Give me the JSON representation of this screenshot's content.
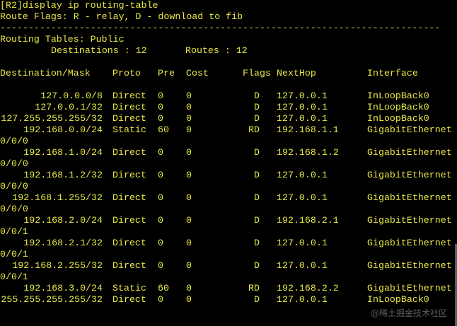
{
  "terminal": {
    "command": "[R2]display ip routing-table",
    "flags_line": "Route Flags: R - relay, D - download to fib",
    "separator": "------------------------------------------------------------------------------",
    "table_title": "Routing Tables: Public",
    "destinations_label": "Destinations : 12",
    "routes_label": "Routes : 12",
    "headers": [
      "Destination/Mask",
      "Proto",
      "Pre",
      "Cost",
      "Flags",
      "NextHop",
      "Interface"
    ],
    "rows": [
      [
        "127.0.0.0/8",
        "Direct",
        "0",
        "0",
        "D",
        "127.0.0.1",
        "InLoopBack0"
      ],
      [
        "127.0.0.1/32",
        "Direct",
        "0",
        "0",
        "D",
        "127.0.0.1",
        "InLoopBack0"
      ],
      [
        "127.255.255.255/32",
        "Direct",
        "0",
        "0",
        "D",
        "127.0.0.1",
        "InLoopBack0"
      ],
      [
        "192.168.0.0/24",
        "Static",
        "60",
        "0",
        "RD",
        "192.168.1.1",
        "GigabitEthernet"
      ],
      [
        "192.168.1.0/24",
        "Direct",
        "0",
        "0",
        "D",
        "192.168.1.2",
        "GigabitEthernet"
      ],
      [
        "192.168.1.2/32",
        "Direct",
        "0",
        "0",
        "D",
        "127.0.0.1",
        "GigabitEthernet"
      ],
      [
        "192.168.1.255/32",
        "Direct",
        "0",
        "0",
        "D",
        "127.0.0.1",
        "GigabitEthernet"
      ],
      [
        "192.168.2.0/24",
        "Direct",
        "0",
        "0",
        "D",
        "192.168.2.1",
        "GigabitEthernet"
      ],
      [
        "192.168.2.1/32",
        "Direct",
        "0",
        "0",
        "D",
        "127.0.0.1",
        "GigabitEthernet"
      ],
      [
        "192.168.2.255/32",
        "Direct",
        "0",
        "0",
        "D",
        "127.0.0.1",
        "GigabitEthernet"
      ],
      [
        "192.168.3.0/24",
        "Static",
        "60",
        "0",
        "RD",
        "192.168.2.2",
        "GigabitEthernet"
      ],
      [
        "255.255.255.255/32",
        "Direct",
        "0",
        "0",
        "D",
        "127.0.0.1",
        "InLoopBack0"
      ]
    ],
    "continuations": [
      "",
      "",
      "",
      "0/0/0",
      "0/0/0",
      "0/0/0",
      "0/0/0",
      "0/0/1",
      "0/0/1",
      "0/0/1",
      "",
      ""
    ]
  },
  "watermark": "@稀土掘金技术社区",
  "colors": {
    "background": "#000000",
    "text": "#e8e84a"
  }
}
